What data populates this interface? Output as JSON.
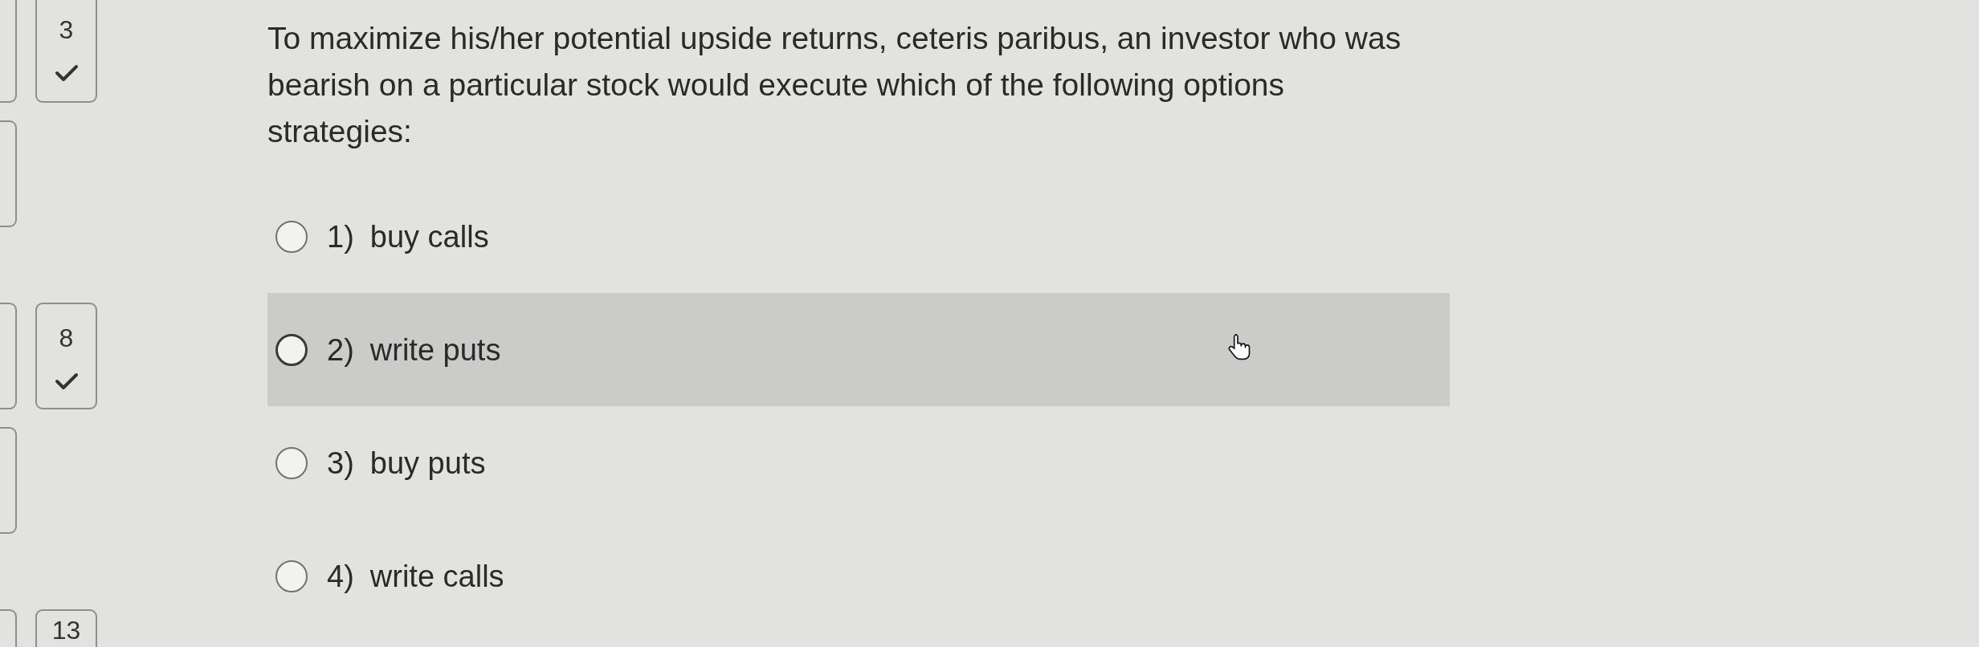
{
  "question_nav": {
    "rows": [
      {
        "tiles": [
          {
            "kind": "cut"
          },
          {
            "kind": "full",
            "number": "3",
            "answered": true
          }
        ]
      },
      {
        "tiles": [
          {
            "kind": "cut"
          }
        ]
      },
      {
        "tiles": [
          {
            "kind": "cut"
          },
          {
            "kind": "full",
            "number": "8",
            "answered": true
          }
        ]
      },
      {
        "tiles": [
          {
            "kind": "cut"
          }
        ]
      },
      {
        "tiles": [
          {
            "kind": "cut"
          },
          {
            "kind": "full",
            "number": "13"
          }
        ]
      }
    ]
  },
  "question": {
    "text": "To maximize his/her potential upside returns, ceteris paribus, an investor who was bearish on a particular stock would execute which of the following options strategies:",
    "options": [
      {
        "number": "1)",
        "label": "buy calls",
        "selected": false,
        "hovered": false
      },
      {
        "number": "2)",
        "label": "write puts",
        "selected": false,
        "hovered": true
      },
      {
        "number": "3)",
        "label": "buy puts",
        "selected": false,
        "hovered": false
      },
      {
        "number": "4)",
        "label": "write calls",
        "selected": false,
        "hovered": false
      }
    ]
  }
}
